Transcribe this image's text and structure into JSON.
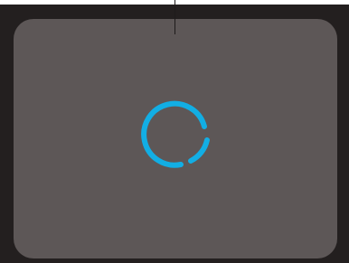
{
  "loading_dialog": {
    "spinner": {
      "icon": "loading-spinner-icon",
      "color": "#12aee4"
    },
    "colors": {
      "frame": "#231f1f",
      "panel": "#5d5757"
    }
  }
}
